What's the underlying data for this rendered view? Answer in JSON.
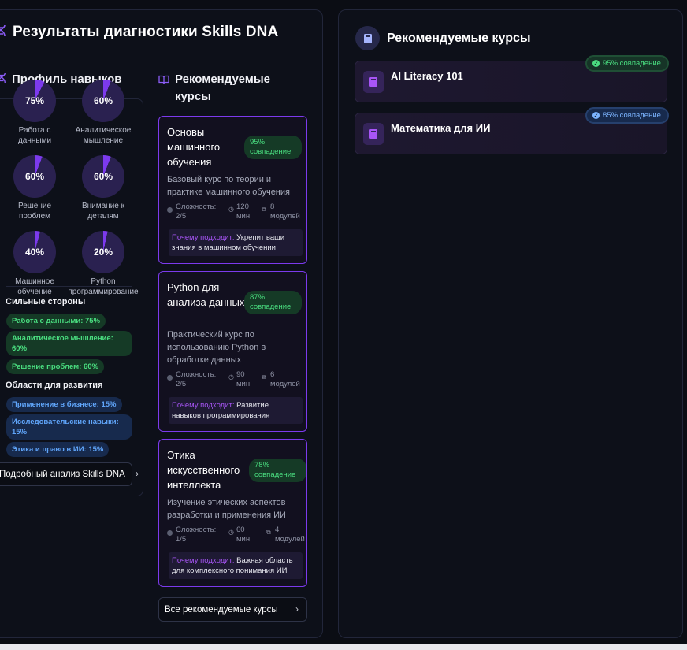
{
  "header": {
    "title": "Результаты диагностики Skills DNA"
  },
  "profile": {
    "title": "Профиль навыков",
    "skills": [
      {
        "percent": "75%",
        "value": 75,
        "label": "Работа с данными"
      },
      {
        "percent": "60%",
        "value": 60,
        "label": "Аналитическое мышление"
      },
      {
        "percent": "60%",
        "value": 60,
        "label": "Решение проблем"
      },
      {
        "percent": "60%",
        "value": 60,
        "label": "Внимание к деталям"
      },
      {
        "percent": "40%",
        "value": 40,
        "label": "Машинное обучение"
      },
      {
        "percent": "20%",
        "value": 20,
        "label": "Python программирование"
      }
    ],
    "strengths_title": "Сильные стороны",
    "strengths": [
      "Работа с данными: 75%",
      "Аналитическое мышление: 60%",
      "Решение проблем: 60%"
    ],
    "growth_title": "Области для развития",
    "growth": [
      "Применение в бизнесе: 15%",
      "Исследовательские навыки: 15%",
      "Этика и право в ИИ: 15%"
    ],
    "detail_button": "Подробный анализ Skills DNA"
  },
  "recommended": {
    "title": "Рекомендуемые курсы",
    "courses": [
      {
        "title": "Основы машинного обучения",
        "match": "95% совпадение",
        "desc": "Базовый курс по теории и практике машинного обучения",
        "difficulty": "Сложность: 2/5",
        "duration": "120 мин",
        "modules": "8 модулей",
        "why_label": "Почему подходит:",
        "why_text": "Укрепит ваши знания в машинном обучении"
      },
      {
        "title": "Python для анализа данных",
        "match": "87% совпадение",
        "desc": "Практический курс по использованию Python в обработке данных",
        "difficulty": "Сложность: 2/5",
        "duration": "90 мин",
        "modules": "6 модулей",
        "why_label": "Почему подходит:",
        "why_text": "Развитие навыков программирования"
      },
      {
        "title": "Этика искусственного интеллекта",
        "match": "78% совпадение",
        "desc": "Изучение этических аспектов разработки и применения ИИ",
        "difficulty": "Сложность: 1/5",
        "duration": "60 мин",
        "modules": "4 модулей",
        "why_label": "Почему подходит:",
        "why_text": "Важная область для комплексного понимания ИИ"
      }
    ],
    "all_button": "Все рекомендуемые курсы"
  },
  "right_panel": {
    "title": "Рекомендуемые курсы",
    "courses": [
      {
        "title": "AI Literacy 101",
        "match": "95% совпадение",
        "status": "green"
      },
      {
        "title": "Математика для ИИ",
        "match": "85% совпадение",
        "status": "blue"
      }
    ]
  },
  "colors": {
    "accent": "#7c3aed",
    "pie_fill": "#7c3aed",
    "pie_bg": "#2a2150",
    "green": "#4ade80",
    "blue": "#60a5fa",
    "background": "#0b0d14"
  }
}
